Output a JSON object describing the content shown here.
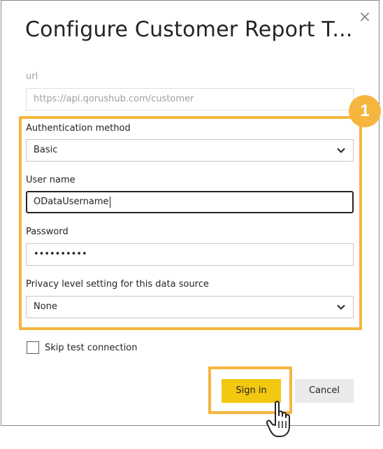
{
  "dialog": {
    "title": "Configure Customer Report T...",
    "close_glyph": "×"
  },
  "url": {
    "label": "url",
    "value": "https://api.qorushub.com/customer"
  },
  "auth": {
    "label": "Authentication method",
    "selected": "Basic"
  },
  "username": {
    "label": "User name",
    "value": "ODataUsername"
  },
  "password": {
    "label": "Password",
    "value": "••••••••••"
  },
  "privacy": {
    "label": "Privacy level setting for this data source",
    "selected": "None"
  },
  "skip_test": {
    "label": "Skip test connection",
    "checked": false
  },
  "buttons": {
    "sign_in": "Sign in",
    "cancel": "Cancel"
  },
  "callout": {
    "number": "1",
    "color": "#f6b53f"
  },
  "icons": {
    "close": "close-icon",
    "chevron": "chevron-down-icon",
    "cursor": "hand-pointer-icon"
  },
  "colors": {
    "accent": "#f2c811",
    "highlight": "#f6b53f"
  }
}
